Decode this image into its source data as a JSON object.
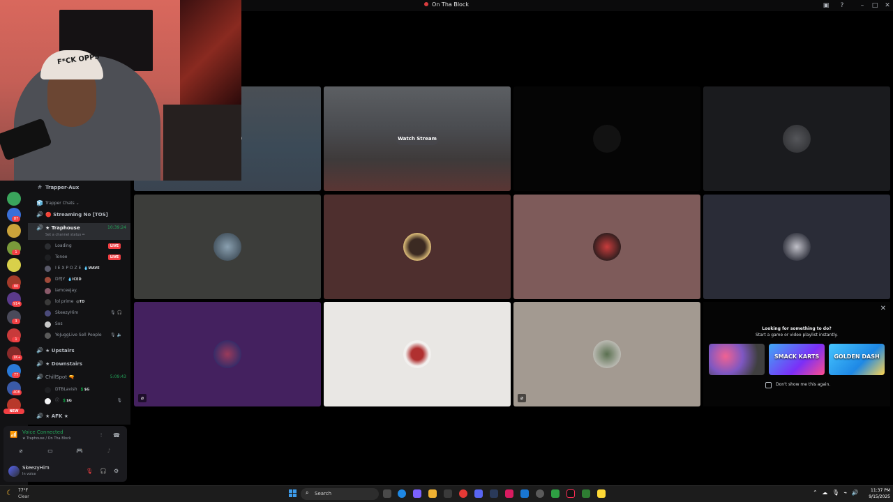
{
  "window": {
    "title": "On Tha Block"
  },
  "webcam": {
    "cap_text": "F*CK OPPS"
  },
  "server_badges": [
    "87",
    "1",
    "80",
    "914",
    "3",
    "1",
    "1K+",
    "77",
    "408"
  ],
  "server_new_label": "NEW",
  "channels": {
    "items": [
      {
        "icon": "#",
        "label": "Trapper-Aux"
      },
      {
        "icon": "🧊",
        "label": "Trapper Chats ⌄"
      },
      {
        "icon": "🔊",
        "label": "🔴 Streaming No [TOS]"
      },
      {
        "icon": "🔊",
        "label": "★ Traphouse",
        "time": "10:39:24",
        "status": "Set a channel status ✏"
      },
      {
        "icon": "🔊",
        "label": "★ Upstairs"
      },
      {
        "icon": "🔊",
        "label": "★ Downstairs"
      },
      {
        "icon": "🔊",
        "label": "ChillSpot 🔫",
        "time": "5:09:43"
      },
      {
        "icon": "🔊",
        "label": "★ AFK ★"
      }
    ],
    "traphouse_members": [
      {
        "name": "Loading",
        "live": "LIVE"
      },
      {
        "name": "Tonee",
        "live": "LIVE"
      },
      {
        "name": "I E X P O Z E",
        "tag": "💧WAVE"
      },
      {
        "name": "D司Y",
        "tag": "💧ICED"
      },
      {
        "name": "iamceejay."
      },
      {
        "name": "lol prime",
        "tag": "◎TD"
      },
      {
        "name": "SkeezyHim",
        "mute": "🎙 🎧"
      },
      {
        "name": "Sos"
      },
      {
        "name": "YoJuggLive Sell People",
        "mute": "🎙 🔈"
      }
    ],
    "chillspot_members": [
      {
        "name": "DTBLavish",
        "tag": "💲$G"
      },
      {
        "name": "ⓘ",
        "tag": "💲$G",
        "mute": "🎙"
      }
    ]
  },
  "voice": {
    "status": "Voice Connected",
    "location": "★ Traphouse / On Tha Block"
  },
  "user": {
    "name": "SkeezyHim",
    "status": "In voice"
  },
  "stage": {
    "watch_label": "Watch Stream",
    "partial_label": "n"
  },
  "activity": {
    "close": "✕",
    "title": "Looking for something to do?",
    "subtitle": "Start a game or video playlist instantly.",
    "games": [
      "",
      "SMACK KARTS",
      "GOLDEN DASH"
    ],
    "checkbox_label": "Don't show me this again."
  },
  "taskbar": {
    "temp": "77°F",
    "condition": "Clear",
    "search_placeholder": "Search",
    "time": "11:37 PM",
    "date": "9/15/2025"
  },
  "colors": {
    "bg": "#000000",
    "sidebar": "#121214",
    "voice_green": "#23a559",
    "live_red": "#f23f43"
  }
}
